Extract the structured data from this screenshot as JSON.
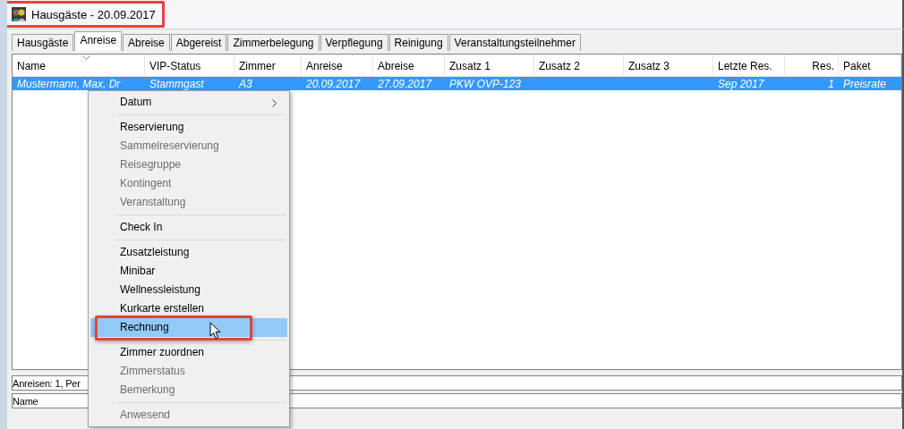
{
  "window": {
    "title": "Hausgäste - 20.09.2017",
    "title_highlighted": true
  },
  "tabs": [
    {
      "label": "Hausgäste",
      "selected": false
    },
    {
      "label": "Anreise",
      "selected": true
    },
    {
      "label": "Abreise",
      "selected": false
    },
    {
      "label": "Abgereist",
      "selected": false
    },
    {
      "label": "Zimmerbelegung",
      "selected": false
    },
    {
      "label": "Verpflegung",
      "selected": false
    },
    {
      "label": "Reinigung",
      "selected": false
    },
    {
      "label": "Veranstaltungsteilnehmer",
      "selected": false
    }
  ],
  "table": {
    "columns": [
      {
        "label": "Name",
        "sorted": true
      },
      {
        "label": "VIP-Status",
        "sorted": false
      },
      {
        "label": "Zimmer",
        "sorted": false
      },
      {
        "label": "Anreise",
        "sorted": false
      },
      {
        "label": "Abreise",
        "sorted": false
      },
      {
        "label": "Zusatz 1",
        "sorted": false
      },
      {
        "label": "Zusatz 2",
        "sorted": false
      },
      {
        "label": "Zusatz 3",
        "sorted": false
      },
      {
        "label": "Letzte Res.",
        "sorted": false
      },
      {
        "label": "Res.",
        "sorted": false
      },
      {
        "label": "Paket",
        "sorted": false
      }
    ],
    "rows": [
      {
        "selected": true,
        "cells": [
          "Mustermann, Max, Dr",
          "Stammgast",
          "A3",
          "20.09.2017",
          "27.09.2017",
          "PKW OVP-123",
          "",
          "",
          "Sep 2017",
          "1",
          "Preisrate"
        ]
      }
    ]
  },
  "status_bar": {
    "summary": "Anreisen: 1, Per",
    "filter_field": "Name"
  },
  "context_menu": {
    "items": [
      {
        "kind": "item",
        "label": "Datum",
        "disabled": false,
        "submenu": true,
        "selected": false,
        "highlighted": false
      },
      {
        "kind": "separator"
      },
      {
        "kind": "item",
        "label": "Reservierung",
        "disabled": false,
        "submenu": false,
        "selected": false,
        "highlighted": false
      },
      {
        "kind": "item",
        "label": "Sammelreservierung",
        "disabled": true,
        "submenu": false,
        "selected": false,
        "highlighted": false
      },
      {
        "kind": "item",
        "label": "Reisegruppe",
        "disabled": true,
        "submenu": false,
        "selected": false,
        "highlighted": false
      },
      {
        "kind": "item",
        "label": "Kontingent",
        "disabled": true,
        "submenu": false,
        "selected": false,
        "highlighted": false
      },
      {
        "kind": "item",
        "label": "Veranstaltung",
        "disabled": true,
        "submenu": false,
        "selected": false,
        "highlighted": false
      },
      {
        "kind": "separator"
      },
      {
        "kind": "item",
        "label": "Check In",
        "disabled": false,
        "submenu": false,
        "selected": false,
        "highlighted": false
      },
      {
        "kind": "separator"
      },
      {
        "kind": "item",
        "label": "Zusatzleistung",
        "disabled": false,
        "submenu": false,
        "selected": false,
        "highlighted": false
      },
      {
        "kind": "item",
        "label": "Minibar",
        "disabled": false,
        "submenu": false,
        "selected": false,
        "highlighted": false
      },
      {
        "kind": "item",
        "label": "Wellnessleistung",
        "disabled": false,
        "submenu": false,
        "selected": false,
        "highlighted": false
      },
      {
        "kind": "item",
        "label": "Kurkarte erstellen",
        "disabled": false,
        "submenu": false,
        "selected": false,
        "highlighted": false
      },
      {
        "kind": "item",
        "label": "Rechnung",
        "disabled": false,
        "submenu": false,
        "selected": true,
        "highlighted": true
      },
      {
        "kind": "separator"
      },
      {
        "kind": "item",
        "label": "Zimmer zuordnen",
        "disabled": false,
        "submenu": false,
        "selected": false,
        "highlighted": false
      },
      {
        "kind": "item",
        "label": "Zimmerstatus",
        "disabled": true,
        "submenu": false,
        "selected": false,
        "highlighted": false
      },
      {
        "kind": "item",
        "label": "Bemerkung",
        "disabled": true,
        "submenu": false,
        "selected": false,
        "highlighted": false
      },
      {
        "kind": "separator"
      },
      {
        "kind": "item",
        "label": "Anwesend",
        "disabled": true,
        "submenu": false,
        "selected": false,
        "highlighted": false
      }
    ]
  }
}
